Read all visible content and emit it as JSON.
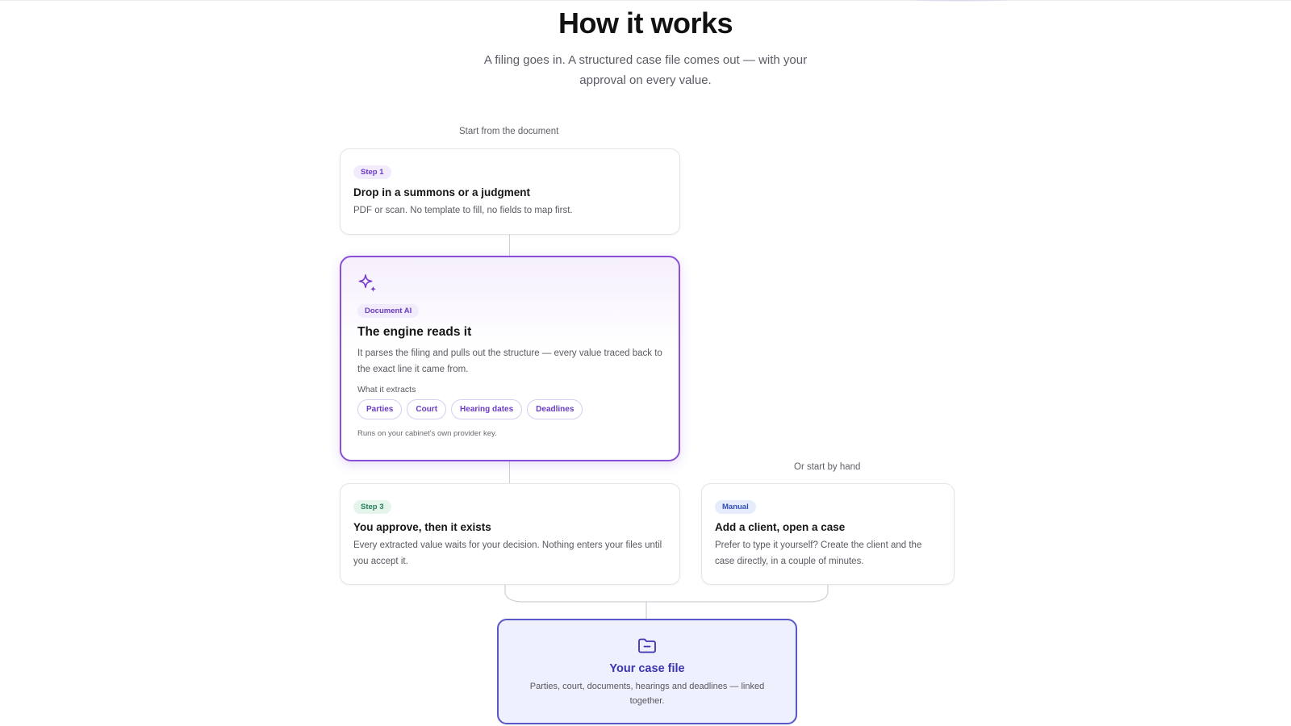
{
  "header": {
    "title": "How it works",
    "subtitle": "A filing goes in. A structured case file comes out — with your approval on every value."
  },
  "captions": {
    "start_document": "Start from the document",
    "start_hand": "Or start by hand"
  },
  "step1": {
    "badge": "Step 1",
    "title": "Drop in a summons or a judgment",
    "description": "PDF or scan. No template to fill, no fields to map first."
  },
  "ai": {
    "icon": "sparkles-icon",
    "badge": "Document AI",
    "title": "The engine reads it",
    "description": "It parses the filing and pulls out the structure — every value traced back to the exact line it came from.",
    "extracts_label": "What it extracts",
    "chips": [
      "Parties",
      "Court",
      "Hearing dates",
      "Deadlines"
    ],
    "footnote": "Runs on your cabinet's own provider key."
  },
  "step3": {
    "badge": "Step 3",
    "title": "You approve, then it exists",
    "description": "Every extracted value waits for your decision. Nothing enters your files until you accept it."
  },
  "manual": {
    "badge": "Manual",
    "title": "Add a client, open a case",
    "description": "Prefer to type it yourself? Create the client and the case directly, in a couple of minutes."
  },
  "case_file": {
    "icon": "folder-icon",
    "title": "Your case file",
    "description": "Parties, court, documents, hearings and deadlines — linked together."
  },
  "colors": {
    "accent_purple": "#8a4fd8",
    "accent_indigo": "#5a57c9",
    "step3_green": "#23805a",
    "manual_blue": "#2f4fb8"
  }
}
